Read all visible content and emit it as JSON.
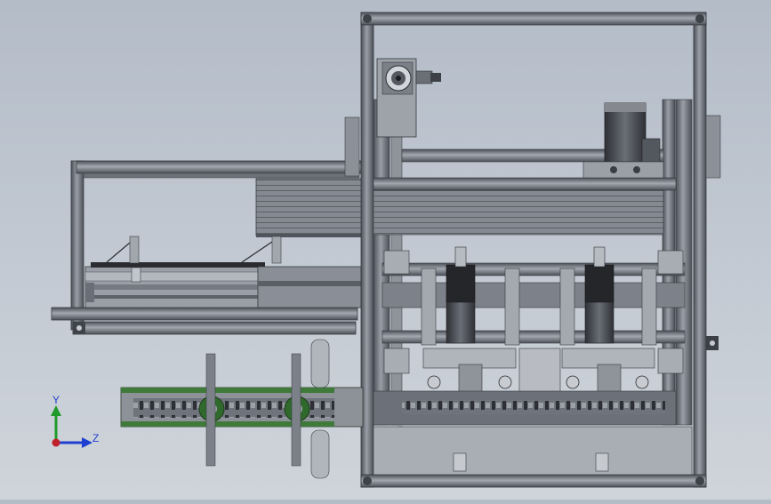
{
  "viewport": {
    "background_top": "#b4bcc8",
    "background_bottom": "#cfd4da"
  },
  "model": {
    "components": [
      "main-frame",
      "servo-motor-top",
      "gear-motor",
      "horizontal-rail",
      "pusher-platform",
      "dual-cylinder-modules",
      "lower-conveyor-chain",
      "green-side-conveyor",
      "base-plate"
    ],
    "frame_color": "#5a5e66",
    "part_fill": "#8e939b",
    "rail_fill": "#7d828a",
    "accent_green": "#3f7a3a",
    "dark_part": "#2a2c30"
  },
  "triad": {
    "y_label": "Y",
    "z_label": "Z",
    "y_color": "#1f9a2a",
    "z_color": "#1f3fd0",
    "origin_color": "#c0202a"
  }
}
